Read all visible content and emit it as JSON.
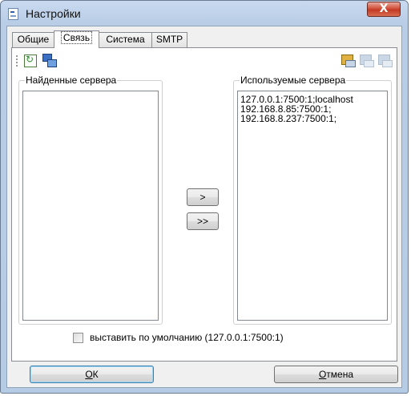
{
  "window": {
    "title": "Настройки",
    "close_glyph": "X"
  },
  "tabs": [
    {
      "label": "Общие",
      "active": false
    },
    {
      "label": "Связь",
      "active": true
    },
    {
      "label": "Система",
      "active": false
    },
    {
      "label": "SMTP",
      "active": false
    }
  ],
  "toolbar": {
    "left_icons": [
      "refresh-icon",
      "network-computers-icon"
    ],
    "right_icons": [
      "add-server-icon",
      "edit-server-icon",
      "remove-server-icon"
    ]
  },
  "found_servers": {
    "label": "Найденные сервера",
    "items": []
  },
  "used_servers": {
    "label": "Используемые сервера",
    "items": [
      "127.0.0.1:7500:1;localhost",
      "192.168.8.85:7500:1;",
      "192.168.8.237:7500:1;"
    ]
  },
  "buttons": {
    "move_one": ">",
    "move_all": ">>",
    "ok_underline": "О",
    "ok_rest": "К",
    "cancel_underline": "О",
    "cancel_rest": "тмена"
  },
  "default_checkbox": {
    "label": "выставить по умолчанию (127.0.0.1:7500:1)",
    "checked": false
  }
}
